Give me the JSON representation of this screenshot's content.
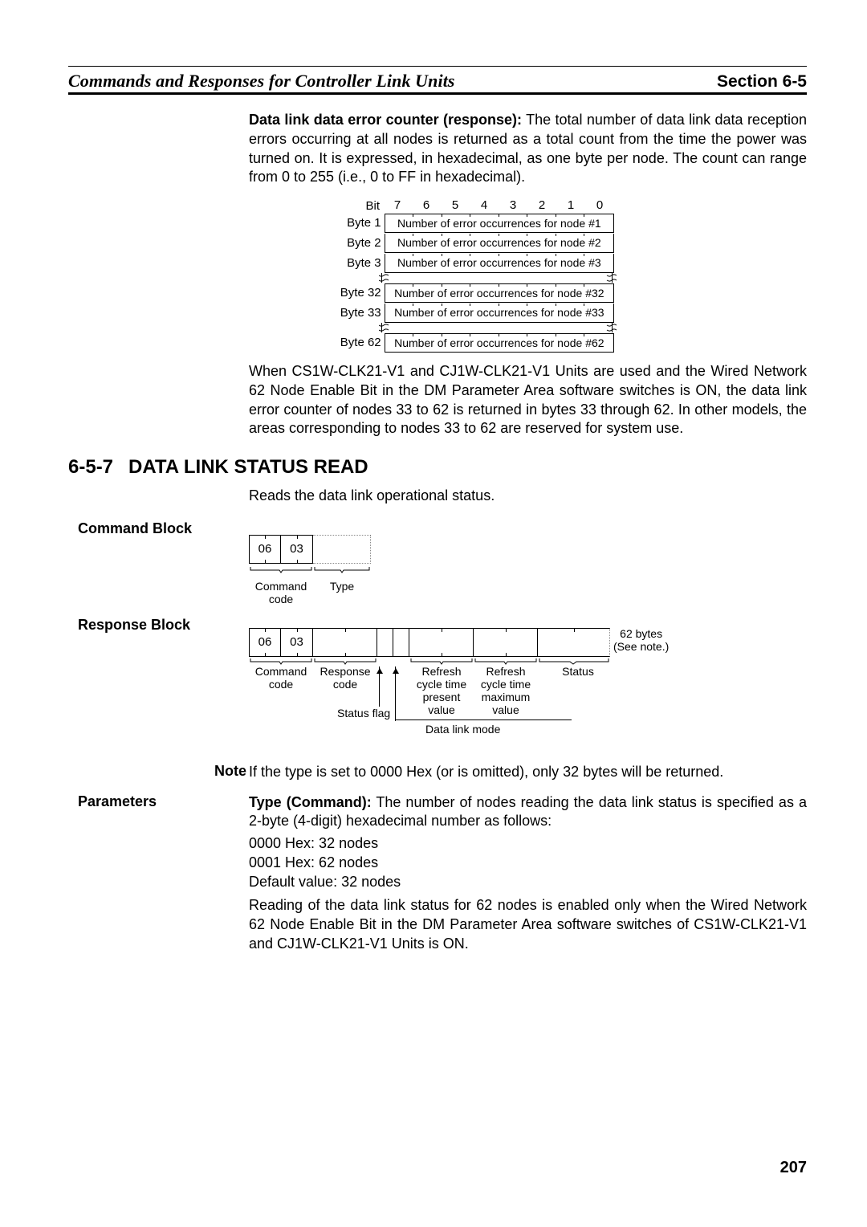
{
  "header": {
    "left": "Commands and Responses for Controller Link Units",
    "right": "Section 6-5"
  },
  "para1_bold": "Data link data error counter (response):",
  "para1_rest": " The total number of data link data reception errors occurring at all nodes is returned as a total count from the time the power was turned on. It is expressed, in hexadecimal, as one byte per node. The count can range from 0 to 255 (i.e., 0 to FF in hexadecimal).",
  "bit_label": "Bit",
  "bits": [
    "7",
    "6",
    "5",
    "4",
    "3",
    "2",
    "1",
    "0"
  ],
  "byte_rows": [
    {
      "label": "Byte 1",
      "text": "Number of error occurrences for node #1"
    },
    {
      "label": "Byte 2",
      "text": "Number of error occurrences for node #2"
    },
    {
      "label": "Byte 3",
      "text": "Number of error occurrences for node #3"
    }
  ],
  "byte_rows2": [
    {
      "label": "Byte 32",
      "text": "Number of error occurrences for node #32"
    },
    {
      "label": "Byte 33",
      "text": "Number of error occurrences for node #33"
    }
  ],
  "byte_rows3": [
    {
      "label": "Byte 62",
      "text": "Number of error occurrences for node #62"
    }
  ],
  "para2": "When CS1W-CLK21-V1 and CJ1W-CLK21-V1 Units are used and the Wired Network 62 Node Enable Bit in the DM Parameter Area software switches is ON, the data link error counter of nodes 33 to 62 is returned in bytes 33 through 62. In other models, the areas corresponding to nodes 33 to 62 are reserved for system use.",
  "section_num": "6-5-7",
  "section_title": "DATA LINK STATUS READ",
  "para3": "Reads the data link operational status.",
  "side_cmd": "Command Block",
  "cmd_cells": [
    "06",
    "03"
  ],
  "cmd_labels": {
    "code": "Command\ncode",
    "type": "Type"
  },
  "side_resp": "Response Block",
  "resp_cells": [
    "06",
    "03"
  ],
  "resp_note": "62 bytes\n(See note.)",
  "resp_labels": {
    "code": "Command\ncode",
    "resp": "Response\ncode",
    "sflag": "Status flag",
    "dlm": "Data link mode",
    "r1": "Refresh\ncycle time\npresent\nvalue",
    "r2": "Refresh\ncycle time\nmaximum\nvalue",
    "status": "Status"
  },
  "note_label": "Note",
  "note_text": "If the type is set to 0000 Hex (or is omitted), only 32 bytes will be returned.",
  "side_params": "Parameters",
  "param_bold": "Type (Command):",
  "param_rest": " The number of nodes reading the data link status is specified as a 2-byte (4-digit) hexadecimal number as follows:",
  "param_lines": [
    "0000 Hex: 32 nodes",
    "0001 Hex: 62 nodes",
    "Default value: 32 nodes"
  ],
  "param_para2": "Reading of the data link status for 62 nodes is enabled only when the Wired Network 62 Node Enable Bit in the DM Parameter Area software switches of CS1W-CLK21-V1 and CJ1W-CLK21-V1 Units is ON.",
  "page_number": "207"
}
